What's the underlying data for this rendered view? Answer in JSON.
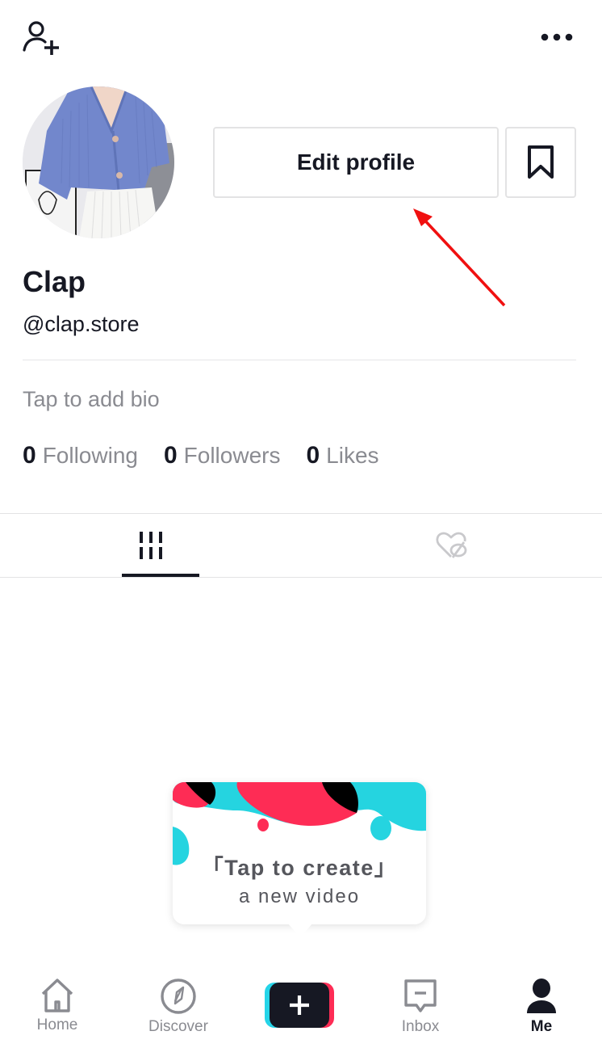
{
  "header": {
    "add_user_icon": "person-add-icon",
    "more_icon": "more-horizontal-icon"
  },
  "profile": {
    "name": "Clap",
    "handle": "@clap.store",
    "edit_profile_label": "Edit profile",
    "bookmark_icon": "bookmark-icon",
    "bio_placeholder": "Tap to add bio",
    "stats": [
      {
        "value": "0",
        "label": "Following"
      },
      {
        "value": "0",
        "label": "Followers"
      },
      {
        "value": "0",
        "label": "Likes"
      }
    ]
  },
  "tabs": [
    {
      "name": "videos",
      "icon": "grid-icon",
      "active": true
    },
    {
      "name": "liked",
      "icon": "liked-private-icon",
      "active": false
    }
  ],
  "create_tooltip": {
    "line1": "「Tap to create」",
    "line2": "a new video"
  },
  "bottom_nav": {
    "items": [
      {
        "label": "Home",
        "icon": "home-icon",
        "active": false
      },
      {
        "label": "Discover",
        "icon": "compass-icon",
        "active": false
      },
      {
        "label": "",
        "icon": "plus-icon",
        "active": false
      },
      {
        "label": "Inbox",
        "icon": "inbox-icon",
        "active": false
      },
      {
        "label": "Me",
        "icon": "person-icon",
        "active": true
      }
    ]
  },
  "colors": {
    "text_primary": "#161823",
    "text_secondary": "#8a8b91",
    "accent_red": "#fe2c55",
    "accent_cyan": "#25f4ee",
    "annotation_arrow": "#f01010"
  }
}
